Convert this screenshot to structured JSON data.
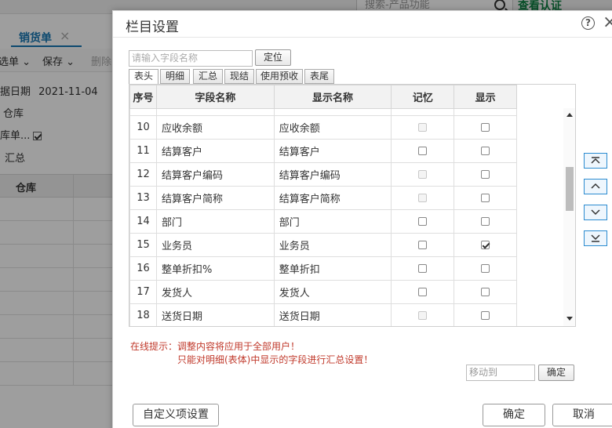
{
  "background": {
    "search_placeholder": "搜索-产品功能",
    "verify_link": "查看认证",
    "tab_label": "销货单",
    "tab_close": "×",
    "toolbar": {
      "item1": "选单",
      "item2": "保存",
      "item3": "删除"
    },
    "form": {
      "date_label": "据日期",
      "date_value": "2021-11-04",
      "warehouse_label": "仓库",
      "checkbox_label": "库单...",
      "summary_label": "汇总"
    },
    "grid_header": "仓库"
  },
  "dialog": {
    "title": "栏目设置",
    "help": "?",
    "close": "×",
    "field_search_placeholder": "请输入字段名称",
    "locate_button": "定位",
    "tabs": [
      "表头",
      "明细",
      "汇总",
      "现结",
      "使用预收",
      "表尾"
    ],
    "columns": [
      "序号",
      "字段名称",
      "显示名称",
      "记忆",
      "显示"
    ],
    "rows": [
      {
        "no": "10",
        "field": "应收余额",
        "display": "应收余额",
        "memory": "disabled",
        "show": "unchecked"
      },
      {
        "no": "11",
        "field": "结算客户",
        "display": "结算客户",
        "memory": "unchecked",
        "show": "unchecked"
      },
      {
        "no": "12",
        "field": "结算客户编码",
        "display": "结算客户编码",
        "memory": "disabled",
        "show": "unchecked"
      },
      {
        "no": "13",
        "field": "结算客户简称",
        "display": "结算客户简称",
        "memory": "disabled",
        "show": "unchecked"
      },
      {
        "no": "14",
        "field": "部门",
        "display": "部门",
        "memory": "unchecked",
        "show": "unchecked"
      },
      {
        "no": "15",
        "field": "业务员",
        "display": "业务员",
        "memory": "unchecked",
        "show": "checked"
      },
      {
        "no": "16",
        "field": "整单折扣%",
        "display": "整单折扣",
        "memory": "unchecked",
        "show": "unchecked"
      },
      {
        "no": "17",
        "field": "发货人",
        "display": "发货人",
        "memory": "unchecked",
        "show": "unchecked"
      },
      {
        "no": "18",
        "field": "送货日期",
        "display": "送货日期",
        "memory": "disabled",
        "show": "unchecked"
      }
    ],
    "hint_line1": "在线提示：调整内容将应用于全部用户！",
    "hint_line2": "只能对明细(表体)中显示的字段进行汇总设置！",
    "moveto_placeholder": "移动到",
    "moveto_confirm": "确定",
    "custom_button": "自定义项设置",
    "ok_button": "确定",
    "cancel_button": "取消"
  },
  "colors": {
    "accent_blue": "#1677b3",
    "hint_red": "#c0392b",
    "verify_green": "#0a7f3f"
  }
}
